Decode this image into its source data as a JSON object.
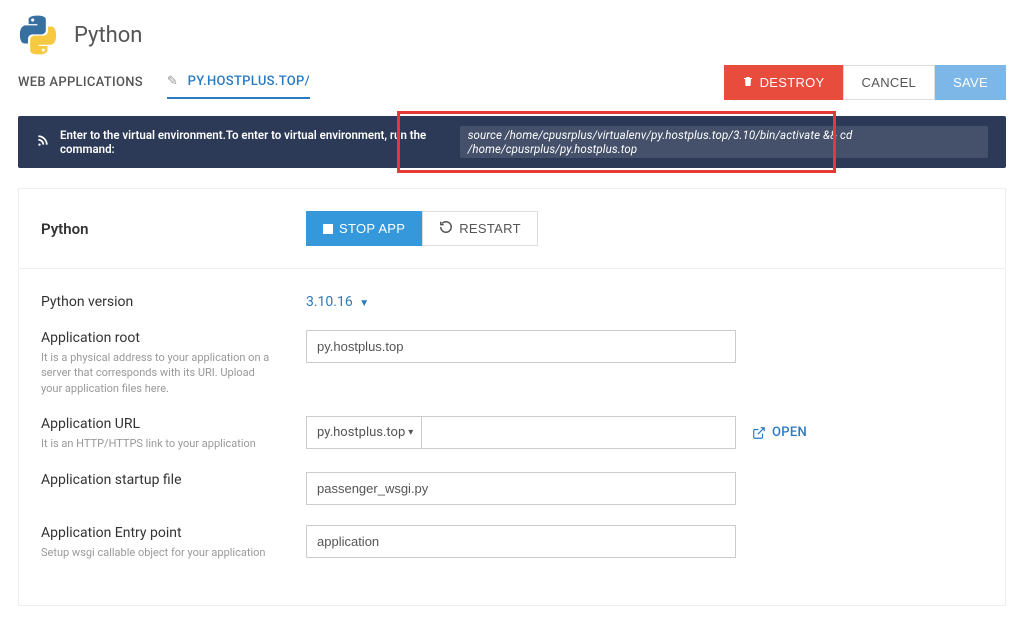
{
  "page": {
    "title": "Python"
  },
  "nav": {
    "web_applications": "WEB APPLICATIONS",
    "current_app": "PY.HOSTPLUS.TOP/"
  },
  "actions": {
    "destroy": "DESTROY",
    "cancel": "CANCEL",
    "save": "SAVE"
  },
  "command_bar": {
    "prefix": "Enter to the virtual environment.To enter to virtual environment, run the command:",
    "snippet": "source /home/cpusrplus/virtualenv/py.hostplus.top/3.10/bin/activate && cd /home/cpusrplus/py.hostplus.top"
  },
  "panel": {
    "title": "Python",
    "stop": "STOP APP",
    "restart": "RESTART"
  },
  "form": {
    "python_version": {
      "label": "Python version",
      "value": "3.10.16"
    },
    "app_root": {
      "label": "Application root",
      "value": "py.hostplus.top",
      "hint": "It is a physical address to your application on a server that corresponds with its URI. Upload your application files here."
    },
    "app_url": {
      "label": "Application URL",
      "value": "py.hostplus.top",
      "hint": "It is an HTTP/HTTPS link to your application",
      "open": "OPEN"
    },
    "startup_file": {
      "label": "Application startup file",
      "value": "passenger_wsgi.py"
    },
    "entry_point": {
      "label": "Application Entry point",
      "value": "application",
      "hint": "Setup wsgi callable object for your application"
    }
  }
}
